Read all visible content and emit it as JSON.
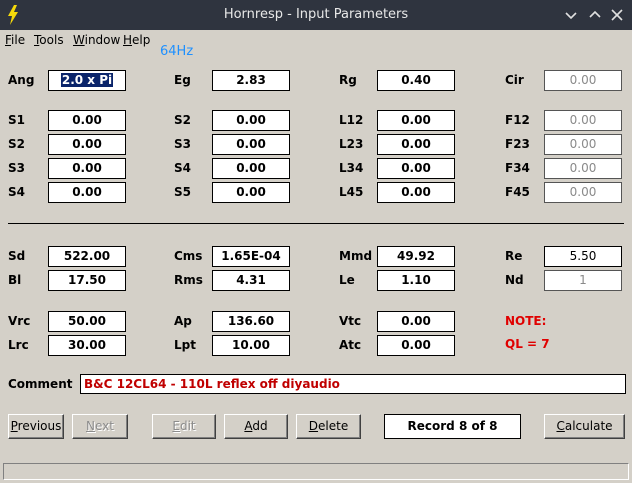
{
  "window": {
    "title": "Hornresp - Input Parameters"
  },
  "menu": {
    "file": "File",
    "tools": "Tools",
    "window": "Window",
    "help": "Help"
  },
  "freq_display": "64Hz",
  "params": {
    "ang": {
      "label": "Ang",
      "value": "2.0 x Pi"
    },
    "eg": {
      "label": "Eg",
      "value": "2.83"
    },
    "rg": {
      "label": "Rg",
      "value": "0.40"
    },
    "cir": {
      "label": "Cir",
      "value": "0.00"
    },
    "s1": {
      "label": "S1",
      "value": "0.00"
    },
    "s2a": {
      "label": "S2",
      "value": "0.00"
    },
    "s3a": {
      "label": "S3",
      "value": "0.00"
    },
    "s4a": {
      "label": "S4",
      "value": "0.00"
    },
    "s2b": {
      "label": "S2",
      "value": "0.00"
    },
    "s3b": {
      "label": "S3",
      "value": "0.00"
    },
    "s4b": {
      "label": "S4",
      "value": "0.00"
    },
    "s5": {
      "label": "S5",
      "value": "0.00"
    },
    "l12": {
      "label": "L12",
      "value": "0.00"
    },
    "l23": {
      "label": "L23",
      "value": "0.00"
    },
    "l34": {
      "label": "L34",
      "value": "0.00"
    },
    "l45": {
      "label": "L45",
      "value": "0.00"
    },
    "f12": {
      "label": "F12",
      "value": "0.00"
    },
    "f23": {
      "label": "F23",
      "value": "0.00"
    },
    "f34": {
      "label": "F34",
      "value": "0.00"
    },
    "f45": {
      "label": "F45",
      "value": "0.00"
    },
    "sd": {
      "label": "Sd",
      "value": "522.00"
    },
    "bl": {
      "label": "Bl",
      "value": "17.50"
    },
    "cms": {
      "label": "Cms",
      "value": "1.65E-04"
    },
    "rms": {
      "label": "Rms",
      "value": "4.31"
    },
    "mmd": {
      "label": "Mmd",
      "value": "49.92"
    },
    "le": {
      "label": "Le",
      "value": "1.10"
    },
    "re": {
      "label": "Re",
      "value": "5.50"
    },
    "nd": {
      "label": "Nd",
      "value": "1"
    },
    "vrc": {
      "label": "Vrc",
      "value": "50.00"
    },
    "lrc": {
      "label": "Lrc",
      "value": "30.00"
    },
    "ap": {
      "label": "Ap",
      "value": "136.60"
    },
    "lpt": {
      "label": "Lpt",
      "value": "10.00"
    },
    "vtc": {
      "label": "Vtc",
      "value": "0.00"
    },
    "atc": {
      "label": "Atc",
      "value": "0.00"
    }
  },
  "note": {
    "label": "NOTE:",
    "text": "QL = 7"
  },
  "comment": {
    "label": "Comment",
    "value": "B&C 12CL64 - 110L reflex off diyaudio"
  },
  "buttons": {
    "previous": "Previous",
    "next": "Next",
    "edit": "Edit",
    "add": "Add",
    "delete": "Delete",
    "calculate": "Calculate"
  },
  "record": "Record 8 of 8",
  "colors": {
    "titlebar": "#2f343f",
    "note": "#e00000",
    "comment_text": "#c00000",
    "freq": "#1e90ff",
    "selection": "#0a246a"
  }
}
